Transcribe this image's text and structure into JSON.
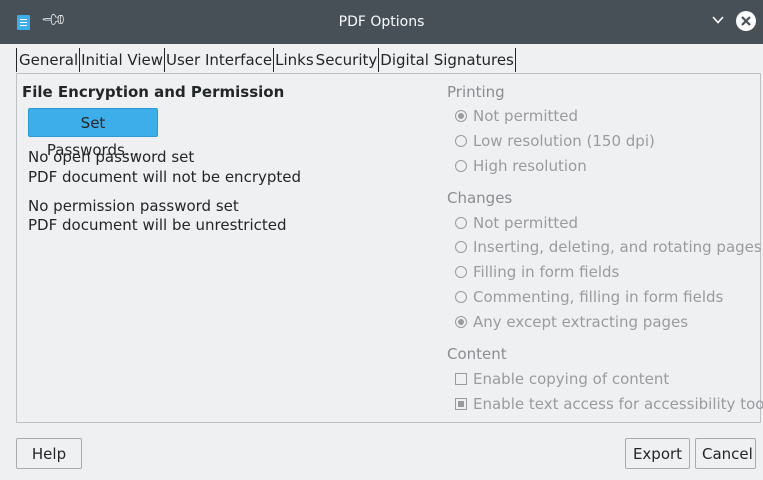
{
  "window": {
    "title": "PDF Options"
  },
  "tabs": [
    "General",
    "Initial View",
    "User Interface",
    "Links",
    "Security",
    "Digital Signatures"
  ],
  "encryption": {
    "heading": "File Encryption and Permission",
    "set_passwords_label": "Set Passwords...",
    "open_line1": "No open password set",
    "open_line2": "PDF document will not be encrypted",
    "perm_line1": "No permission password set",
    "perm_line2": "PDF document will be unrestricted"
  },
  "printing": {
    "heading": "Printing",
    "options": [
      {
        "label": "Not permitted",
        "selected": true
      },
      {
        "label": "Low resolution (150 dpi)",
        "selected": false
      },
      {
        "label": "High resolution",
        "selected": false
      }
    ]
  },
  "changes": {
    "heading": "Changes",
    "options": [
      {
        "label": "Not permitted",
        "selected": false
      },
      {
        "label": "Inserting, deleting, and rotating pages",
        "selected": false
      },
      {
        "label": "Filling in form fields",
        "selected": false
      },
      {
        "label": "Commenting, filling in form fields",
        "selected": false
      },
      {
        "label": "Any except extracting pages",
        "selected": true
      }
    ]
  },
  "content": {
    "heading": "Content",
    "options": [
      {
        "label": "Enable copying of content",
        "checked": false
      },
      {
        "label": "Enable text access for accessibility tools",
        "checked": true
      }
    ]
  },
  "footer": {
    "help_label": "Help",
    "export_label": "Export",
    "cancel_label": "Cancel"
  },
  "colors": {
    "titlebar": "#475057",
    "accent": "#3daee9",
    "background": "#eff0f1"
  }
}
